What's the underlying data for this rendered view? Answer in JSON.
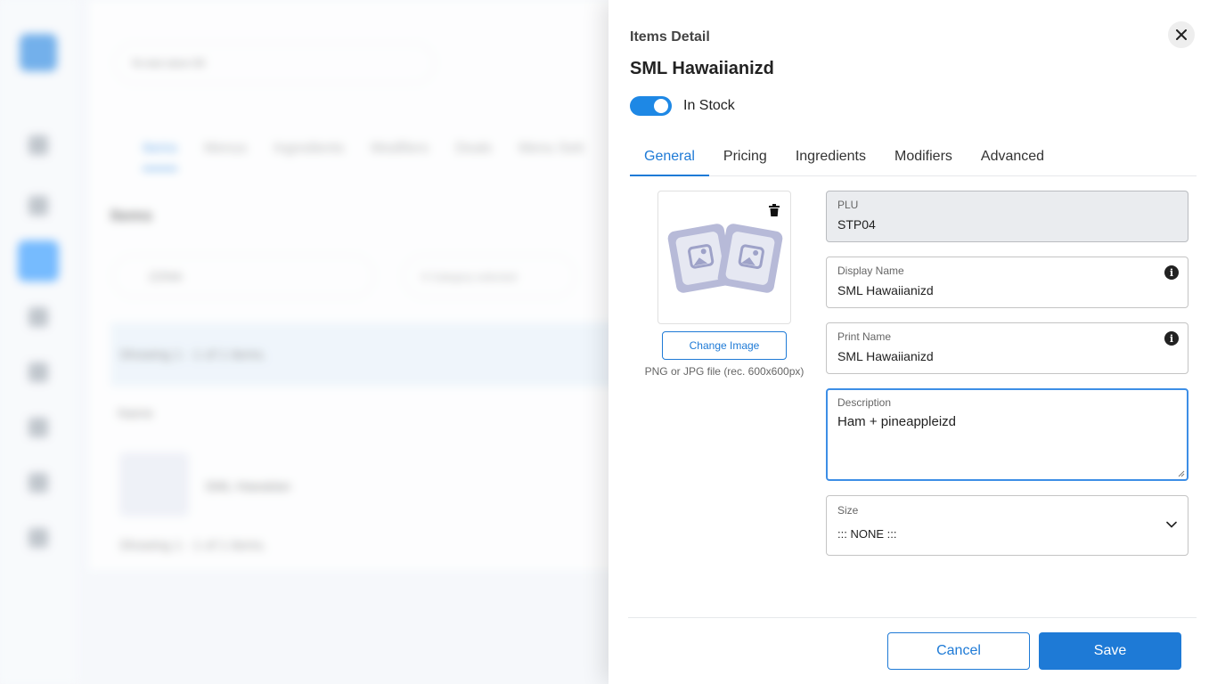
{
  "background": {
    "store_selector": "Ye test store 00",
    "tabs": [
      "Items",
      "Menus",
      "Ingredients",
      "Modifiers",
      "Deals",
      "Menu Sett"
    ],
    "heading": "Items",
    "search_value": "ZZINA",
    "category_filter": "0 Category selected",
    "showing_top": "Showing 1 - 1 of 1 items.",
    "name_header": "Name",
    "row_item": "SML Hawaiian",
    "showing_bottom": "Showing 1 - 1 of 1 items."
  },
  "drawer": {
    "label": "Items Detail",
    "title": "SML Hawaiianizd",
    "in_stock": {
      "label": "In Stock",
      "checked": true
    },
    "tabs": [
      "General",
      "Pricing",
      "Ingredients",
      "Modifiers",
      "Advanced"
    ],
    "active_tab": "General",
    "image": {
      "change_label": "Change Image",
      "hint": "PNG or JPG file (rec. 600x600px)"
    },
    "fields": {
      "plu": {
        "label": "PLU",
        "value": "STP04"
      },
      "display_name": {
        "label": "Display Name",
        "value": "SML Hawaiianizd"
      },
      "print_name": {
        "label": "Print Name",
        "value": "SML Hawaiianizd"
      },
      "description": {
        "label": "Description",
        "value": "Ham + pineappleizd"
      },
      "size": {
        "label": "Size",
        "value": "::: NONE :::"
      }
    },
    "buttons": {
      "cancel": "Cancel",
      "save": "Save"
    }
  },
  "colors": {
    "accent": "#1e7ad6",
    "toggle": "#1e88e5"
  }
}
